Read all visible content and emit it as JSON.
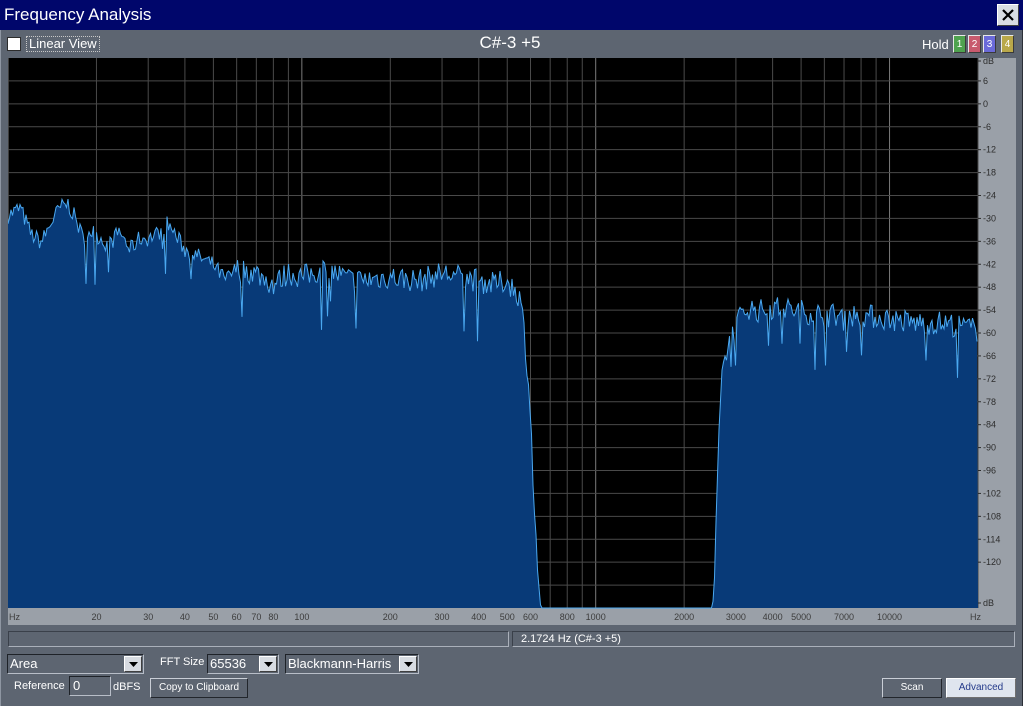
{
  "window": {
    "title": "Frequency Analysis",
    "close_icon": "close-icon"
  },
  "toolbar": {
    "linear_view_label": "Linear View",
    "linear_view_checked": false,
    "note_readout": "C#-3 +5",
    "hold_label": "Hold",
    "hold_buttons": [
      {
        "label": "1",
        "color": "#4fa24f"
      },
      {
        "label": "2",
        "color": "#c85a6e"
      },
      {
        "label": "3",
        "color": "#6a6ad8"
      },
      {
        "label": "4",
        "color": "#b9a84a"
      }
    ]
  },
  "status": {
    "left_text": "",
    "right_text": "2.1724 Hz (C#-3 +5)"
  },
  "controls": {
    "display_mode": "Area",
    "fft_size_label": "FFT Size",
    "fft_size": "65536",
    "window_function": "Blackmann-Harris",
    "reference_label": "Reference",
    "reference_value": "0",
    "reference_unit": "dBFS",
    "copy_button": "Copy to Clipboard",
    "scan_button": "Scan",
    "advanced_button": "Advanced"
  },
  "chart_data": {
    "type": "area",
    "xlabel": "Hz",
    "ylabel": "dB",
    "x_scale": "log",
    "xlim": [
      10,
      20000
    ],
    "ylim": [
      -132,
      12
    ],
    "grid": true,
    "x_tick_labels": [
      "Hz",
      "20",
      "30",
      "40",
      "50",
      "60",
      "70",
      "80",
      "100",
      "200",
      "300",
      "400",
      "500",
      "600",
      "800",
      "1000",
      "2000",
      "3000",
      "4000",
      "5000",
      "7000",
      "10000",
      "Hz"
    ],
    "y_tick_labels": [
      "dB",
      "6",
      "0",
      "-6",
      "-12",
      "-18",
      "-24",
      "-30",
      "-36",
      "-42",
      "-48",
      "-54",
      "-60",
      "-66",
      "-72",
      "-78",
      "-84",
      "-90",
      "-96",
      "-102",
      "-108",
      "-114",
      "-120",
      "dB"
    ],
    "colors": {
      "background": "#000000",
      "fill": "#083a78",
      "line": "#4aa8f0",
      "grid": "#5a5a5a"
    },
    "series": [
      {
        "x": [
          10,
          11,
          12,
          13,
          14,
          15,
          16,
          17,
          18,
          19,
          20,
          22,
          24,
          26,
          28,
          30,
          32,
          35,
          40,
          45,
          50,
          55,
          60,
          70,
          80,
          90,
          100,
          120,
          150,
          200,
          250,
          300,
          350,
          400,
          450,
          500,
          550,
          570,
          600,
          620,
          650,
          700,
          800,
          1000,
          1500,
          2000,
          2300,
          2400,
          2500,
          2550,
          2600,
          2700,
          2800,
          3000,
          3300,
          3600,
          4000,
          5000,
          6000,
          7000,
          8000,
          10000,
          12000,
          15000,
          18000,
          20000
        ],
        "values": [
          -29,
          -27,
          -34,
          -36,
          -31,
          -27,
          -26,
          -30,
          -35,
          -33,
          -34,
          -37,
          -33,
          -38,
          -35,
          -35,
          -34,
          -31,
          -38,
          -40,
          -42,
          -46,
          -43,
          -44,
          -47,
          -44,
          -45,
          -43,
          -46,
          -45,
          -46,
          -44,
          -45,
          -46,
          -47,
          -46,
          -50,
          -58,
          -80,
          -110,
          -132,
          -132,
          -132,
          -132,
          -132,
          -132,
          -132,
          -132,
          -132,
          -120,
          -95,
          -70,
          -64,
          -57,
          -53,
          -54,
          -53,
          -54,
          -55,
          -55,
          -55,
          -56,
          -57,
          -57,
          -58,
          -59
        ]
      }
    ]
  }
}
